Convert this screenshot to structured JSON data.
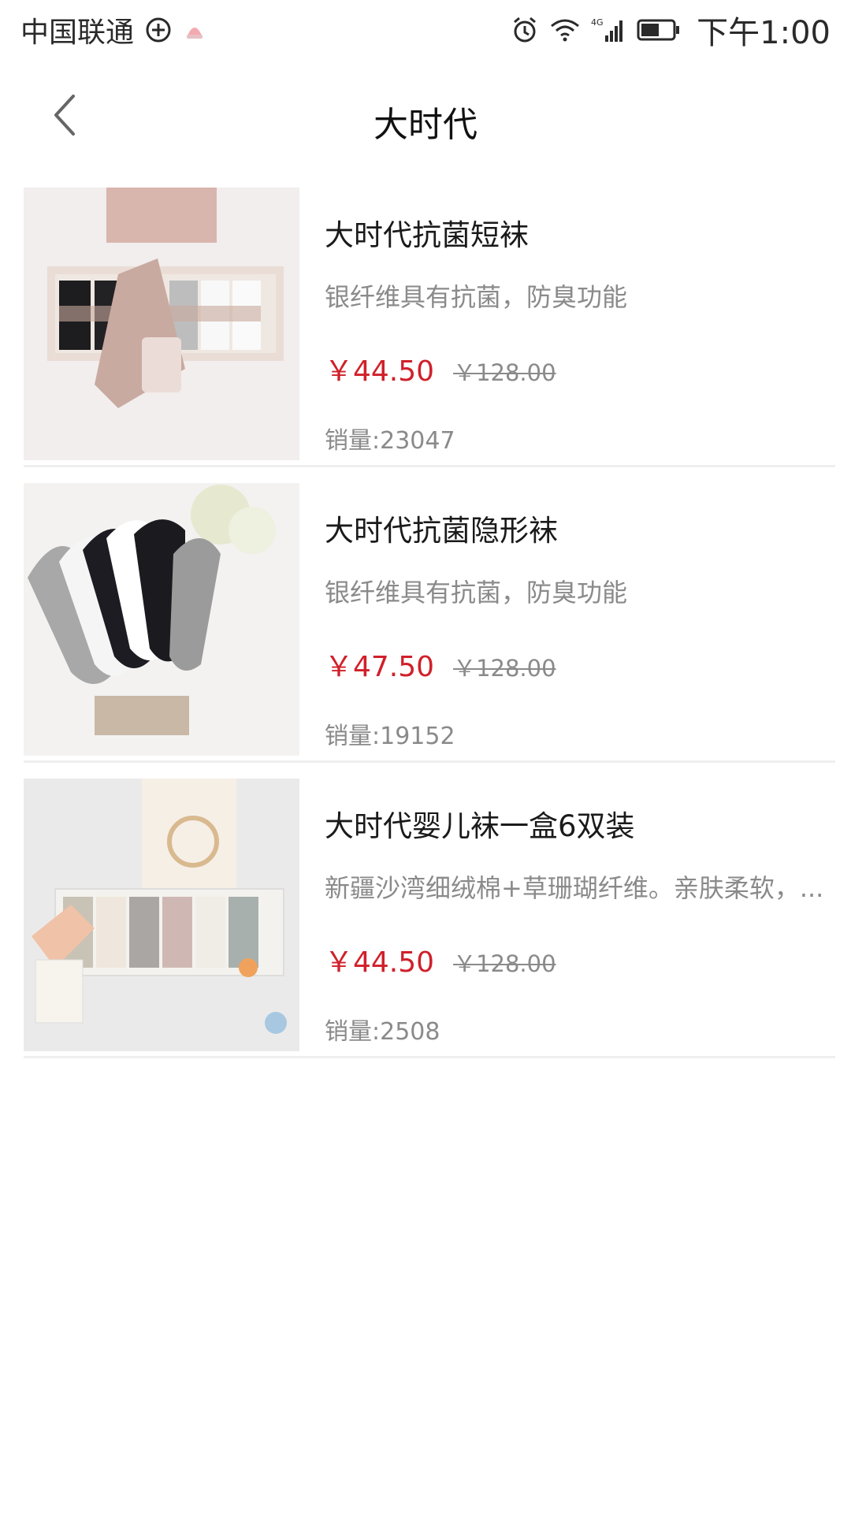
{
  "status_bar": {
    "carrier": "中国联通",
    "network_badge": "4G",
    "time": "下午1:00",
    "icons": [
      "plus-circle-icon",
      "app-notification-icon",
      "alarm-icon",
      "wifi-icon",
      "signal-icon",
      "battery-icon"
    ]
  },
  "header": {
    "title": "大时代",
    "back_icon": "chevron-left-icon"
  },
  "colors": {
    "price_red": "#d0202a",
    "muted_gray": "#8a8a8a",
    "title_black": "#111111"
  },
  "products": [
    {
      "name": "大时代抗菌短袜",
      "desc": "银纤维具有抗菌，防臭功能",
      "price": "￥44.50",
      "original_price": "￥128.00",
      "sales": "销量:23047"
    },
    {
      "name": "大时代抗菌隐形袜",
      "desc": "银纤维具有抗菌，防臭功能",
      "price": "￥47.50",
      "original_price": "￥128.00",
      "sales": "销量:19152"
    },
    {
      "name": "大时代婴儿袜一盒6双装",
      "desc": "新疆沙湾细绒棉+草珊瑚纤维。亲肤柔软，...",
      "price": "￥44.50",
      "original_price": "￥128.00",
      "sales": "销量:2508"
    }
  ]
}
